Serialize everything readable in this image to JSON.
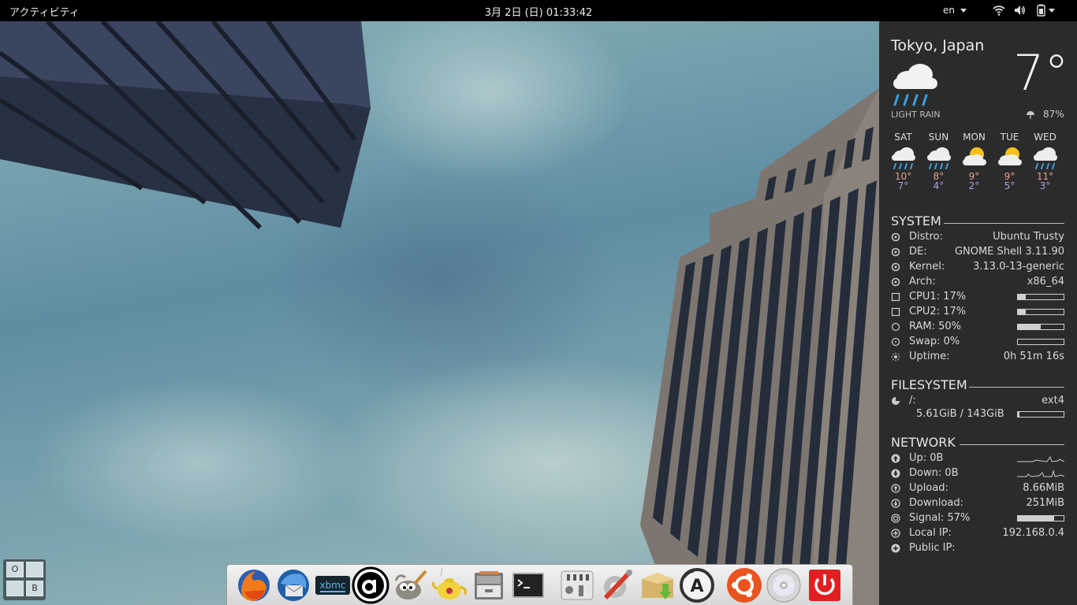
{
  "topbar": {
    "activities": "アクティビティ",
    "clock": "3月 2日 (日) 01:33:42",
    "language": "en"
  },
  "weather": {
    "location": "Tokyo, Japan",
    "temperature": "7°",
    "condition": "LIGHT RAIN",
    "humidity": "87%",
    "forecast": [
      {
        "day": "SAT",
        "icon": "rain-cloud-icon",
        "high": "10°",
        "low": "7°"
      },
      {
        "day": "SUN",
        "icon": "rain-cloud-icon",
        "high": "8°",
        "low": "4°"
      },
      {
        "day": "MON",
        "icon": "sun-cloud-icon",
        "high": "9°",
        "low": "2°"
      },
      {
        "day": "TUE",
        "icon": "sun-cloud-icon",
        "high": "9°",
        "low": "5°"
      },
      {
        "day": "WED",
        "icon": "rain-cloud-icon",
        "high": "11°",
        "low": "3°"
      }
    ]
  },
  "system": {
    "title": "SYSTEM",
    "rows": [
      {
        "label": "Distro:",
        "value": "Ubuntu Trusty"
      },
      {
        "label": "DE:",
        "value": "GNOME Shell 3.11.90"
      },
      {
        "label": "Kernel:",
        "value": "3.13.0-13-generic"
      },
      {
        "label": "Arch:",
        "value": "x86_64"
      },
      {
        "label": "CPU1: 17%",
        "level": 0.17
      },
      {
        "label": "CPU2: 17%",
        "level": 0.17
      },
      {
        "label": "RAM: 50%",
        "level": 0.5
      },
      {
        "label": "Swap: 0%",
        "level": 0.0
      },
      {
        "label": "Uptime:",
        "value": "0h 51m 16s"
      }
    ]
  },
  "filesystem": {
    "title": "FILESYSTEM",
    "mount": "/:",
    "type": "ext4",
    "usage": "5.61GiB / 143GiB",
    "level": 0.04
  },
  "network": {
    "title": "NETWORK",
    "rows": [
      {
        "label": "Up: 0B",
        "graph": true
      },
      {
        "label": "Down: 0B",
        "graph": true
      },
      {
        "label": "Upload:",
        "value": "8.66MiB"
      },
      {
        "label": "Download:",
        "value": "251MiB"
      },
      {
        "label": "Signal: 57%",
        "level": 0.8
      },
      {
        "label": "Local IP:",
        "value": "192.168.0.4"
      },
      {
        "label": "Public IP:",
        "value": ""
      }
    ]
  },
  "workspaces": [
    "O",
    "",
    "",
    "B"
  ],
  "dock": [
    "firefox-icon",
    "thunderbird-icon",
    "xbmc-icon",
    "amazon-icon",
    "gimp-icon",
    "teapot-icon",
    "files-icon",
    "terminal-icon",
    "mixer-icon",
    "settings-icon",
    "package-install-icon",
    "software-updater-icon",
    "ubuntu-icon",
    "cd-icon",
    "power-icon"
  ]
}
